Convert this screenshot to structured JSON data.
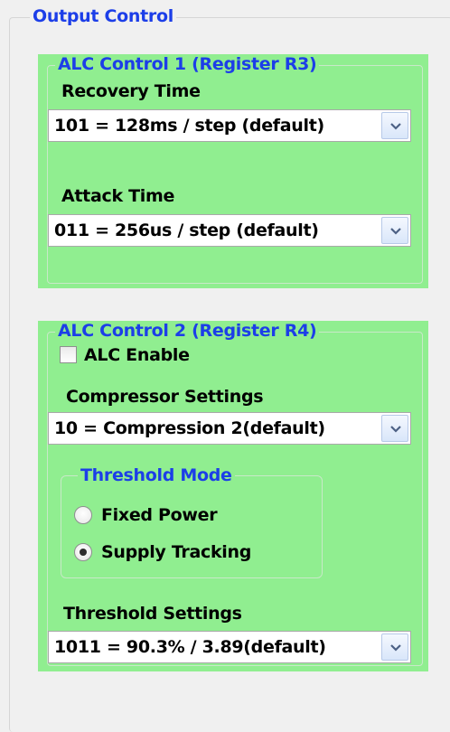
{
  "output_control": {
    "title": "Output Control"
  },
  "alc1": {
    "title": "ALC Control 1 (Register R3)",
    "recovery_label": "Recovery Time",
    "recovery_value": "101 = 128ms / step (default)",
    "attack_label": "Attack Time",
    "attack_value": "011 = 256us / step (default)"
  },
  "alc2": {
    "title": "ALC Control 2 (Register R4)",
    "alc_enable_label": "ALC Enable",
    "alc_enable_checked": false,
    "compressor_label": "Compressor Settings",
    "compressor_value": "10 = Compression 2(default)",
    "threshold_mode": {
      "title": "Threshold Mode",
      "options": [
        "Fixed Power",
        "Supply Tracking"
      ],
      "selected": "Supply Tracking"
    },
    "threshold_label": "Threshold Settings",
    "threshold_value": "1011 = 90.3% / 3.89(default)"
  },
  "colors": {
    "panel_green": "#90ee90",
    "legend_blue": "#1c3ee8",
    "background": "#f0f0f0"
  }
}
